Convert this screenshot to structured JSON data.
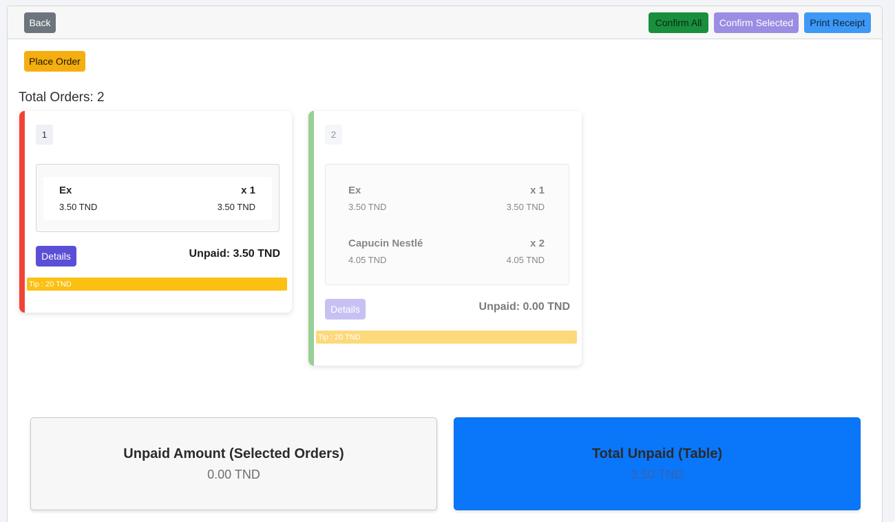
{
  "toolbar": {
    "back_label": "Back",
    "confirm_all_label": "Confirm All",
    "confirm_selected_label": "Confirm Selected",
    "print_receipt_label": "Print Receipt"
  },
  "place_order_label": "Place Order",
  "total_orders_text": "Total Orders: 2",
  "orders": [
    {
      "number": "1",
      "status_color": "#f24236",
      "items": [
        {
          "name": "Ex",
          "qty": "x 1",
          "unit_price": "3.50 TND",
          "line_total": "3.50 TND"
        }
      ],
      "details_label": "Details",
      "unpaid_text": "Unpaid: 3.50 TND",
      "tip_text": "Tip : 20 TND"
    },
    {
      "number": "2",
      "status_color": "#97cf96",
      "items": [
        {
          "name": "Ex",
          "qty": "x 1",
          "unit_price": "3.50 TND",
          "line_total": "3.50 TND"
        },
        {
          "name": "Capucin Nestlé",
          "qty": "x 2",
          "unit_price": "4.05 TND",
          "line_total": "4.05 TND"
        }
      ],
      "details_label": "Details",
      "unpaid_text": "Unpaid: 0.00 TND",
      "tip_text": "Tip : 20 TND"
    }
  ],
  "summary": {
    "selected_title": "Unpaid Amount (Selected Orders)",
    "selected_value": "0.00 TND",
    "table_title": "Total Unpaid (Table)",
    "table_value": "3.50 TND"
  },
  "colors": {
    "back": "#6c757d",
    "confirm_all": "#198f3d",
    "confirm_selected": "#9a8de3",
    "print_receipt": "#3d99f5",
    "place_order": "#f5ae0f",
    "details": "#5a4fd6",
    "tip": "#fbc012",
    "total_unpaid_card": "#0a77fb"
  }
}
